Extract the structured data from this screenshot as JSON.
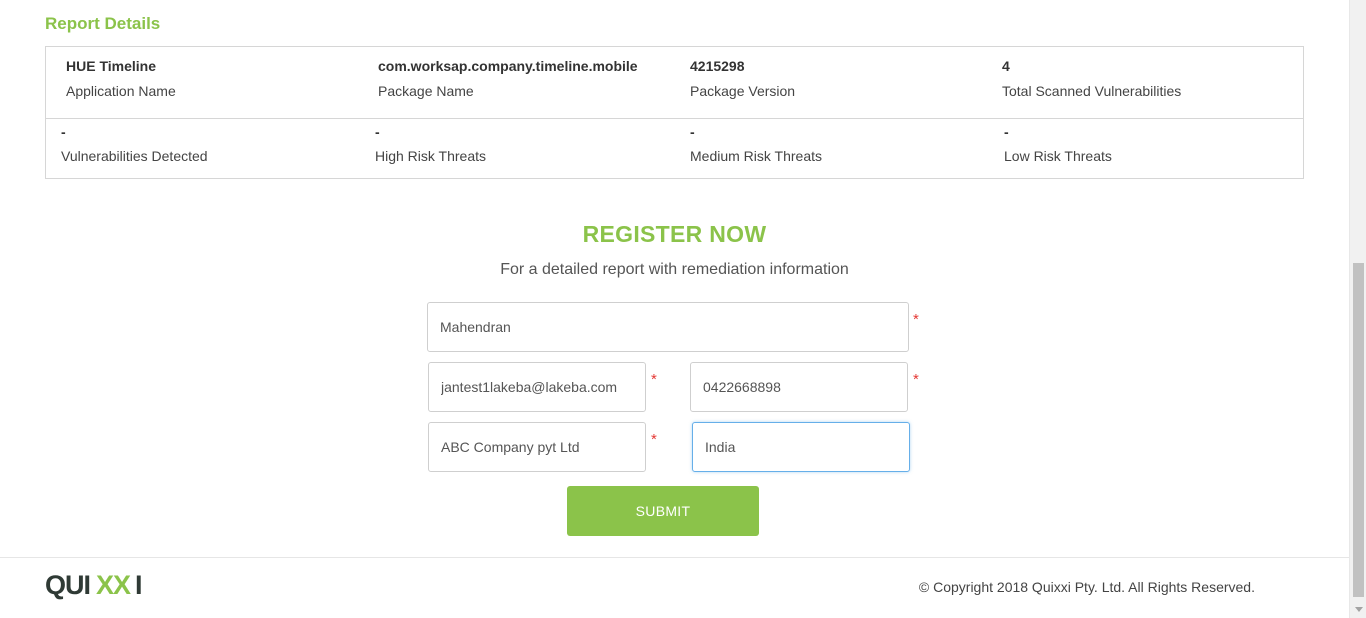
{
  "report": {
    "title": "Report Details",
    "row1": [
      {
        "value": "HUE Timeline",
        "label": "Application Name"
      },
      {
        "value": "com.worksap.company.timeline.mobile",
        "label": "Package Name"
      },
      {
        "value": "4215298",
        "label": "Package Version"
      },
      {
        "value": "4",
        "label": "Total Scanned Vulnerabilities"
      }
    ],
    "row2": [
      {
        "value": "-",
        "label": "Vulnerabilities Detected"
      },
      {
        "value": "-",
        "label": "High Risk Threats"
      },
      {
        "value": "-",
        "label": "Medium Risk Threats"
      },
      {
        "value": "-",
        "label": "Low Risk Threats"
      }
    ]
  },
  "register": {
    "title": "REGISTER NOW",
    "subtitle": "For a detailed report with remediation information",
    "required_mark": "*",
    "fields": {
      "name": "Mahendran",
      "email": "jantest1lakeba@lakeba.com",
      "phone": "0422668898",
      "company": "ABC Company pyt Ltd",
      "country": "India"
    },
    "submit_label": "SUBMIT"
  },
  "footer": {
    "logo_text": "QUIXXI",
    "copyright": "© Copyright 2018 Quixxi Pty. Ltd. All Rights Reserved."
  },
  "colors": {
    "accent": "#8bc34a",
    "required": "#e53935",
    "focus": "#66afe9"
  }
}
